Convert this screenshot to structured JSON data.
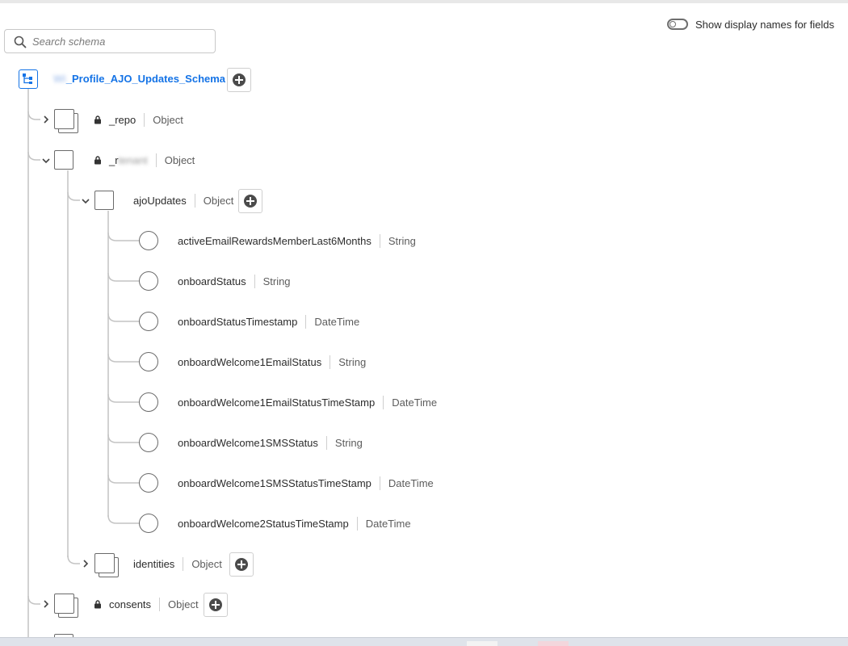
{
  "search": {
    "placeholder": "Search schema",
    "value": ""
  },
  "display_names_toggle": {
    "label": "Show display names for fields",
    "on": false
  },
  "root": {
    "name_prefix_redacted": "Wi",
    "name": "_Profile_AJO_Updates_Schema"
  },
  "nodes": [
    {
      "name": "_repo",
      "type": "Object",
      "locked": true,
      "expanded": false
    },
    {
      "name_prefix": "_r",
      "name_redacted": "tenant",
      "type": "Object",
      "locked": true,
      "expanded": true
    },
    {
      "name": "ajoUpdates",
      "type": "Object",
      "expanded": true
    },
    {
      "name": "identities",
      "type": "Object",
      "expanded": false
    },
    {
      "name": "consents",
      "type": "Object",
      "locked": true,
      "expanded": false
    }
  ],
  "fields": [
    {
      "name": "activeEmailRewardsMemberLast6Months",
      "type": "String"
    },
    {
      "name": "onboardStatus",
      "type": "String"
    },
    {
      "name": "onboardStatusTimestamp",
      "type": "DateTime"
    },
    {
      "name": "onboardWelcome1EmailStatus",
      "type": "String"
    },
    {
      "name": "onboardWelcome1EmailStatusTimeStamp",
      "type": "DateTime"
    },
    {
      "name": "onboardWelcome1SMSStatus",
      "type": "String"
    },
    {
      "name": "onboardWelcome1SMSStatusTimeStamp",
      "type": "DateTime"
    },
    {
      "name": "onboardWelcome2StatusTimeStamp",
      "type": "DateTime"
    }
  ],
  "colors": {
    "accent": "#1473e6",
    "line": "#c4c4c4",
    "icon": "#6a6a6a"
  }
}
